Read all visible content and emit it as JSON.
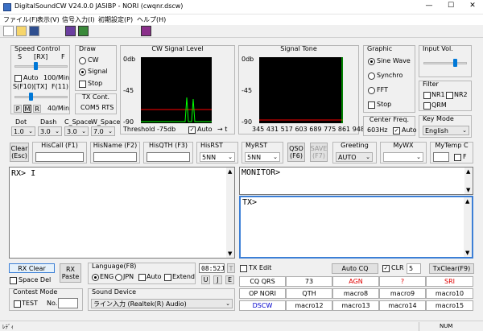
{
  "title": "DigitalSoundCW V24.0.0 JA5IBP - NORI (cwqnr.dscw)",
  "window_controls": {
    "min": "—",
    "max": "☐",
    "close": "✕"
  },
  "menu": [
    "ファイル(F)",
    "表示(V)",
    "信号入力(I)",
    "初期設定(P)",
    "ヘルプ(H)"
  ],
  "speed": {
    "title": "Speed Control",
    "s": "S",
    "rx": "[RX]",
    "f": "F",
    "auto": "Auto",
    "rx_speed": "100/Min",
    "sf10": "S(F10)",
    "tx": "[TX]",
    "f11": "F(11)",
    "p": "P",
    "m": "M",
    "r": "R",
    "tx_speed": "40/Min",
    "rx_level": 0.45,
    "tx_level": 0.35
  },
  "draw": {
    "title": "Draw",
    "cw": "CW",
    "signal": "Signal",
    "stop": "Stop",
    "selected": "Signal",
    "tx_cont_title": "TX Cont.",
    "tx_cont": "COM5 RTS"
  },
  "cw_level": {
    "title": "CW Signal Level",
    "top": "0db",
    "mid": "-45",
    "bot": "-90",
    "threshold": "Threshold -75db",
    "auto": "Auto",
    "arrow": "→ t"
  },
  "tone": {
    "title": "Signal Tone",
    "top": "0db",
    "mid": "-45",
    "bot": "-90",
    "freqs": "345 431 517 603 689 775 861 948Hz"
  },
  "graphic": {
    "title": "Graphic",
    "options": [
      "Sine Wave",
      "Synchro",
      "FFT"
    ],
    "selected": "Sine Wave",
    "stop": "Stop",
    "center_title": "Center Freq.",
    "center": "603Hz",
    "auto": "Auto"
  },
  "input_vol": {
    "title": "Input Vol.",
    "level": 0.7
  },
  "filter": {
    "title": "Filter",
    "nr1": "NR1",
    "nr2": "NR2",
    "qrm": "QRM"
  },
  "key_mode": {
    "title": "Key Mode",
    "value": "English"
  },
  "params": {
    "dot_label": "Dot",
    "dot": "1.0",
    "dash_label": "Dash",
    "dash": "3.0",
    "cspace_label": "C_Space",
    "cspace": "3.0",
    "wspace_label": "W_Space",
    "wspace": "7.0"
  },
  "callrow": {
    "clear": "Clear (Esc)",
    "hiscall": "HisCall (F1)",
    "hisname": "HisName (F2)",
    "hisqth": "HisQTH (F3)",
    "hisrst": "HisRST",
    "hisrst_val": "5NN",
    "myrst": "MyRST",
    "myrst_val": "5NN",
    "qso": "QSO (F6)",
    "save": "SAVE (F7)",
    "greeting": "Greeting",
    "greeting_val": "AUTO",
    "mywx": "MyWX",
    "mytemp": "MyTemp C",
    "f": "F"
  },
  "rx_text": "RX> I",
  "monitor_text": "MONITOR>",
  "tx_text": "TX>",
  "bottom": {
    "rx_clear": "RX Clear",
    "rx_paste": "RX Paste",
    "space_del": "Space Del",
    "lang_title": "Language(F8)",
    "lang": [
      "ENG",
      "JPN",
      "Auto",
      "Extend"
    ],
    "lang_selected": "ENG",
    "time": "08:52J",
    "t_btn": "T",
    "u": "U",
    "j": "J",
    "e": "E",
    "contest_title": "Contest Mode",
    "test": "TEST",
    "no": "No.",
    "sound_title": "Sound Device",
    "sound": "ライン入力 (Realtek(R) Audio)"
  },
  "macros": {
    "tx_edit": "TX Edit",
    "auto_cq": "Auto CQ",
    "clr": "CLR",
    "clr_num": "5",
    "txclear": "TxClear(F9)",
    "row1": [
      "CQ QRS",
      "73",
      "AGN",
      "?",
      "SRI"
    ],
    "row2": [
      "OP NORI",
      "QTH",
      "macro8",
      "macro9",
      "macro10"
    ],
    "row3": [
      "DSCW",
      "macro12",
      "macro13",
      "macro14",
      "macro15"
    ]
  },
  "status": {
    "left": "ﾚﾃﾞｨ",
    "right": "NUM"
  },
  "colors": {
    "red": "#e00000",
    "blue": "#0000cc",
    "scope_line": "#00ff00",
    "scope_red": "#ff0000",
    "titlebar": "#ffffff"
  }
}
